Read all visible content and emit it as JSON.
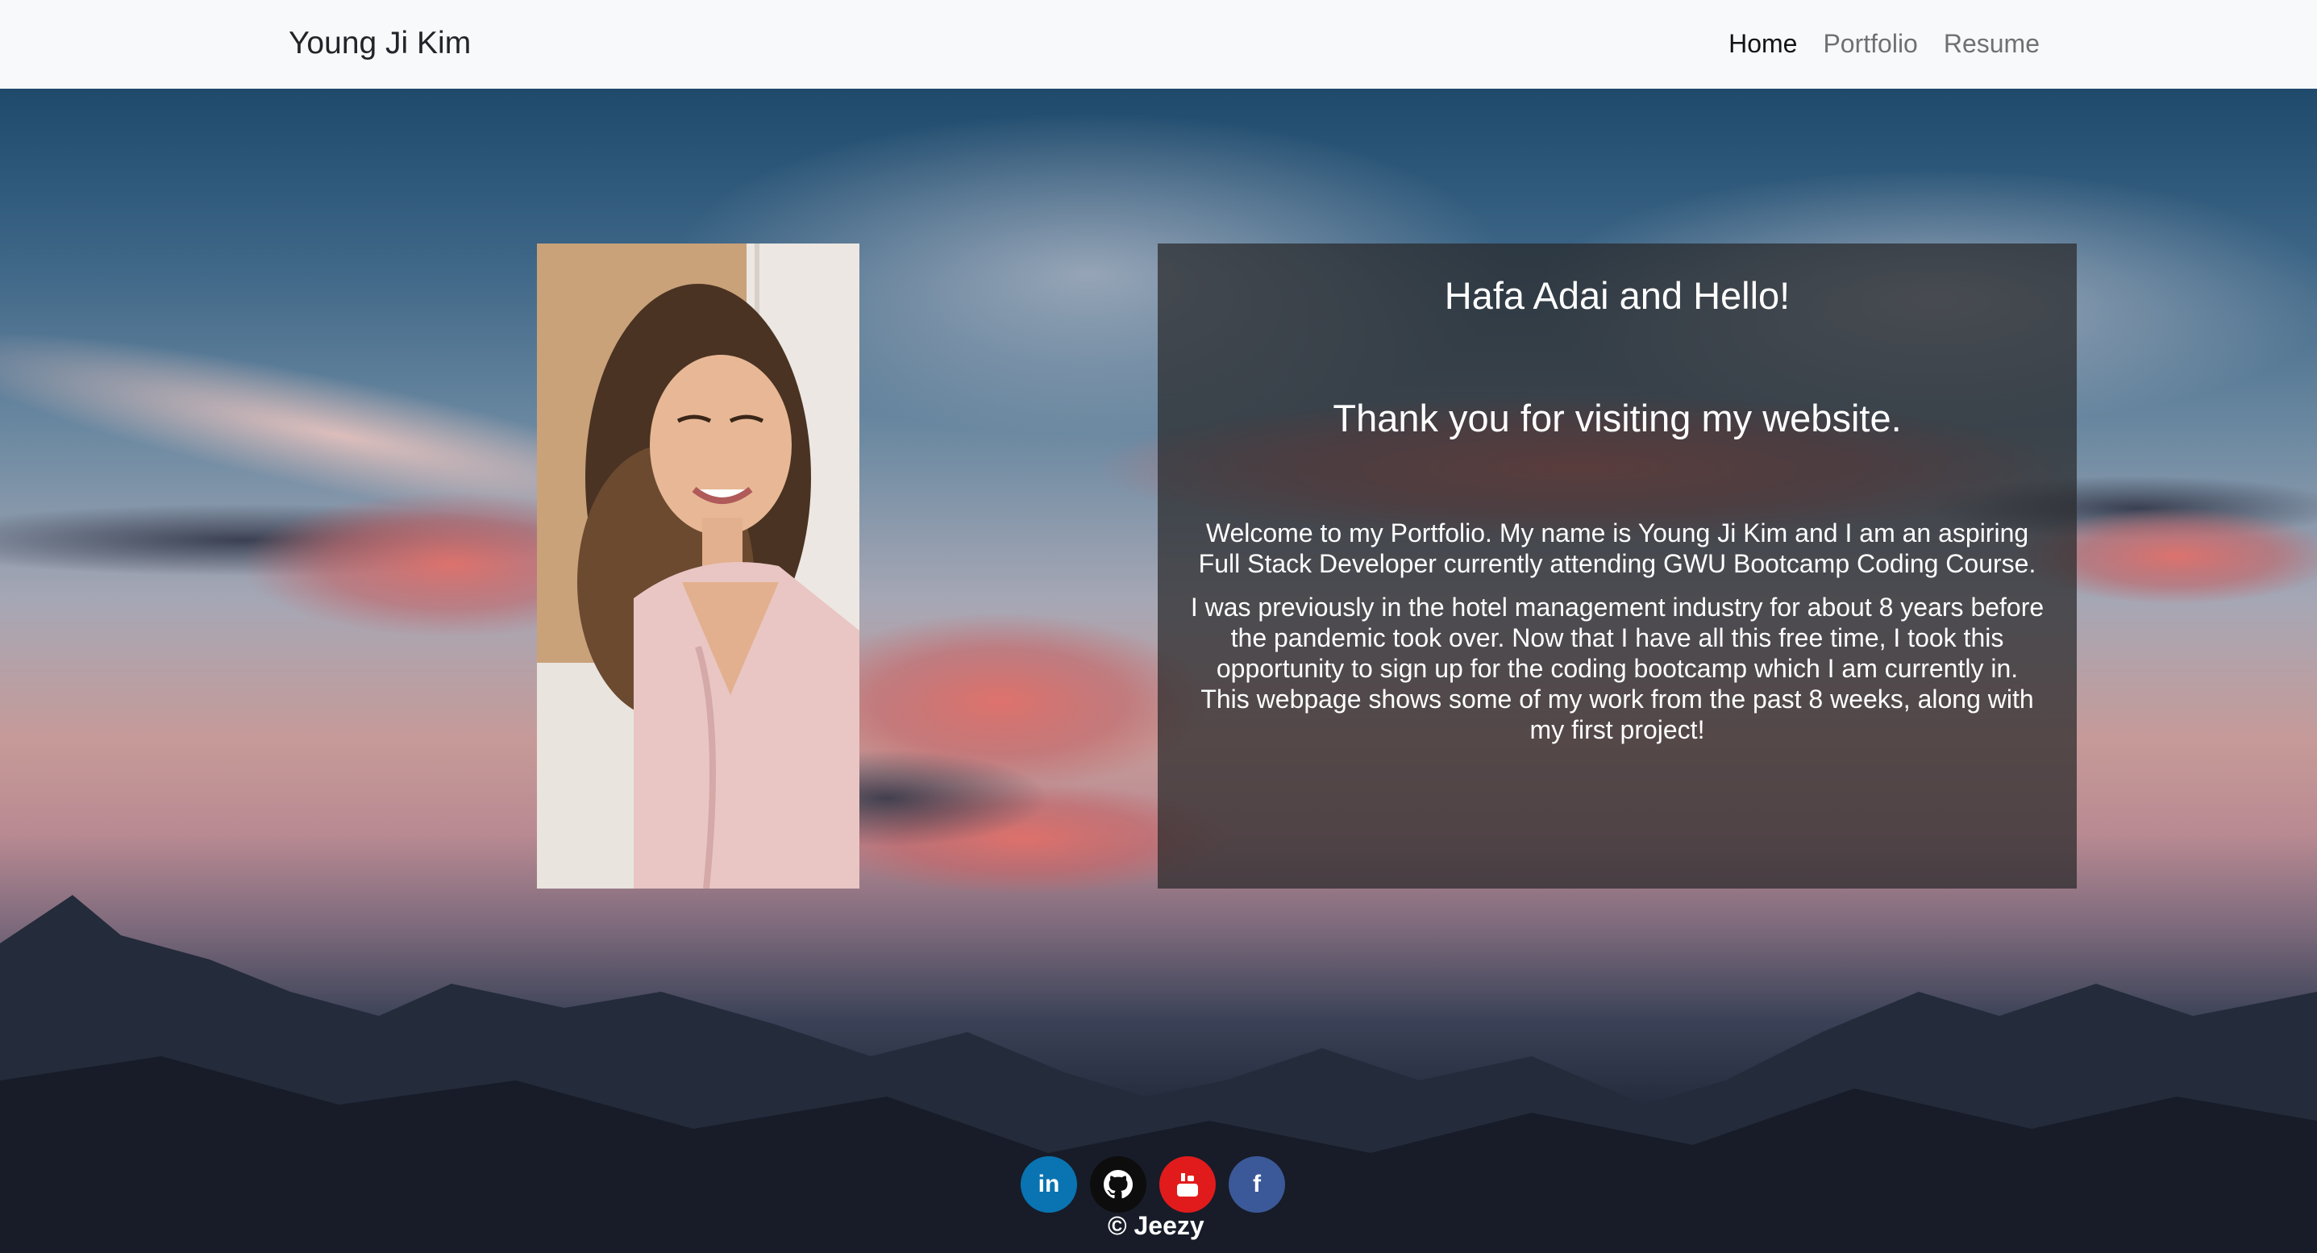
{
  "navbar": {
    "brand": "Young Ji Kim",
    "links": [
      {
        "label": "Home",
        "active": true
      },
      {
        "label": "Portfolio",
        "active": false
      },
      {
        "label": "Resume",
        "active": false
      }
    ]
  },
  "intro": {
    "greeting": "Hafa Adai and Hello!",
    "thanks": "Thank you for visiting my website.",
    "paragraph1": "Welcome to my Portfolio. My name is Young Ji Kim and I am an aspiring Full Stack Developer currently attending GWU Bootcamp Coding Course.",
    "paragraph2": "I was previously in the hotel management industry for about 8 years before the pandemic took over. Now that I have all this free time, I took this opportunity to sign up for the coding bootcamp which I am currently in. This webpage shows some of my work from the past 8 weeks, along with my first project!"
  },
  "footer": {
    "socials": [
      {
        "name": "linkedin-icon",
        "glyph": "in",
        "color": "#0a73b1"
      },
      {
        "name": "github-icon",
        "glyph": "",
        "color": "#0d0d0d"
      },
      {
        "name": "youtube-icon",
        "glyph": "",
        "color": "#e11b1b"
      },
      {
        "name": "facebook-icon",
        "glyph": "f",
        "color": "#3b5998"
      }
    ],
    "copyright": "© Jeezy"
  },
  "colors": {
    "navbar_bg": "#f8f9fa",
    "card_bg": "rgba(40,40,42,0.72)",
    "linkedin": "#0a73b1",
    "github": "#0d0d0d",
    "youtube": "#e11b1b",
    "facebook": "#3b5998"
  }
}
